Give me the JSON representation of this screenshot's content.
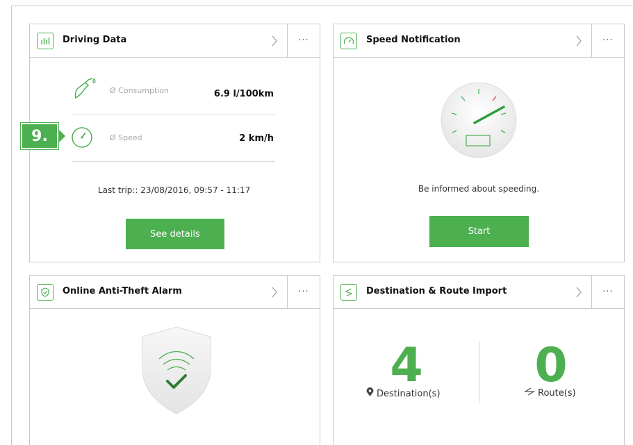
{
  "cards": {
    "driving_data": {
      "title": "Driving Data",
      "more": "···",
      "consumption_label": "Ø Consumption",
      "consumption_value": "6.9 l/100km",
      "speed_label": "Ø Speed",
      "speed_value": "2 km/h",
      "last_trip": "Last trip:: 23/08/2016, 09:57 - 11:17",
      "button": "See details",
      "callout": "9."
    },
    "speed_notification": {
      "title": "Speed Notification",
      "more": "···",
      "message": "Be informed about speeding.",
      "button": "Start"
    },
    "anti_theft": {
      "title": "Online Anti-Theft Alarm",
      "more": "···"
    },
    "route_import": {
      "title": "Destination & Route Import",
      "more": "···",
      "destinations_count": "4",
      "destinations_label": "Destination(s)",
      "routes_count": "0",
      "routes_label": "Route(s)"
    }
  },
  "colors": {
    "accent": "#4caf50",
    "border": "#c9c9c9",
    "alert_red": "#e53935"
  },
  "icons": {
    "driving_data": "bar-chart-icon",
    "speed_notification": "speedometer-icon",
    "anti_theft": "shield-icon",
    "route_import": "route-icon",
    "consumption": "fuel-pump-icon",
    "speed": "speed-gauge-icon",
    "more": "more-dots-icon",
    "chevron": "chevron-right-icon",
    "location": "location-pin-icon",
    "route": "route-arrow-icon"
  }
}
